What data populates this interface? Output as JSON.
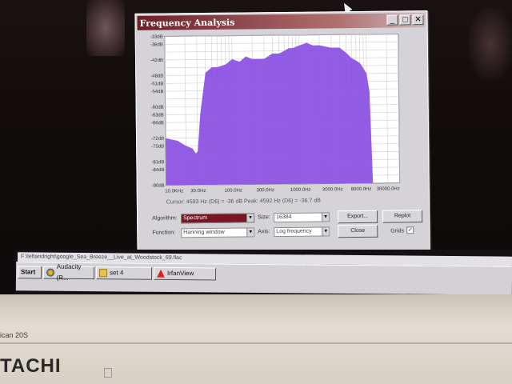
{
  "window": {
    "title": "Frequency Analysis",
    "buttons": [
      "_",
      "□",
      "✕"
    ]
  },
  "chart_data": {
    "type": "area",
    "x_scale": "log",
    "y_unit": "dB",
    "y_ticks": [
      "-33dB",
      "-36dB",
      "-42dB",
      "-48dB",
      "-51dB",
      "-54dB",
      "-60dB",
      "-63dB",
      "-66dB",
      "-72dB",
      "-75dB",
      "-81dB",
      "-84dB",
      "-90dB"
    ],
    "x_ticks": [
      "10.0KHz",
      "30.0Hz",
      "100.0Hz",
      "300.0Hz",
      "1000.0Hz",
      "3000.0Hz",
      "8000.0Hz",
      "30000.0Hz"
    ],
    "x": [
      10,
      15,
      20,
      25,
      28,
      30,
      33,
      40,
      50,
      60,
      80,
      100,
      130,
      160,
      200,
      300,
      400,
      500,
      600,
      700,
      800,
      1000,
      1300,
      1600,
      2000,
      3000,
      4000,
      5000,
      6000,
      7000,
      8000,
      9000,
      10000,
      11000,
      12000
    ],
    "values": [
      -72,
      -73,
      -75,
      -76,
      -78,
      -77,
      -63,
      -47,
      -45,
      -45,
      -44,
      -42,
      -43,
      -41,
      -42,
      -42,
      -40,
      -40,
      -39,
      -38,
      -38,
      -37,
      -36,
      -37,
      -37,
      -38,
      -38,
      -40,
      -42,
      -43,
      -44,
      -46,
      -48,
      -55,
      -90
    ],
    "ylim": [
      -90,
      -33
    ],
    "xlim": [
      10,
      30000
    ],
    "grid": true,
    "fill_color": "#8a4ee2"
  },
  "info": {
    "text": "Cursor: 4593 Hz (D6) = -36 dB    Peak: 4592 Hz (D6) = -36.7 dB"
  },
  "controls": {
    "algorithm_label": "Algorithm:",
    "algorithm_value": "Spectrum",
    "size_label": "Size:",
    "size_value": "16384",
    "function_label": "Function:",
    "function_value": "Hanning window",
    "axis_label": "Axis:",
    "axis_value": "Log frequency",
    "export_label": "Export...",
    "replot_label": "Replot",
    "close_label": "Close",
    "grids_label": "Grids",
    "grids_checked": "✓"
  },
  "pathbar": {
    "text": "F:\\leftandright\\google_Sea_Breeze__Live_at_Woodstock_69.flac"
  },
  "taskbar": {
    "start": "Start",
    "items": [
      "Audacity (R...",
      "set 4",
      "IrfanView"
    ]
  },
  "monitor": {
    "brand": "TACHI",
    "model": "ican 20S"
  }
}
